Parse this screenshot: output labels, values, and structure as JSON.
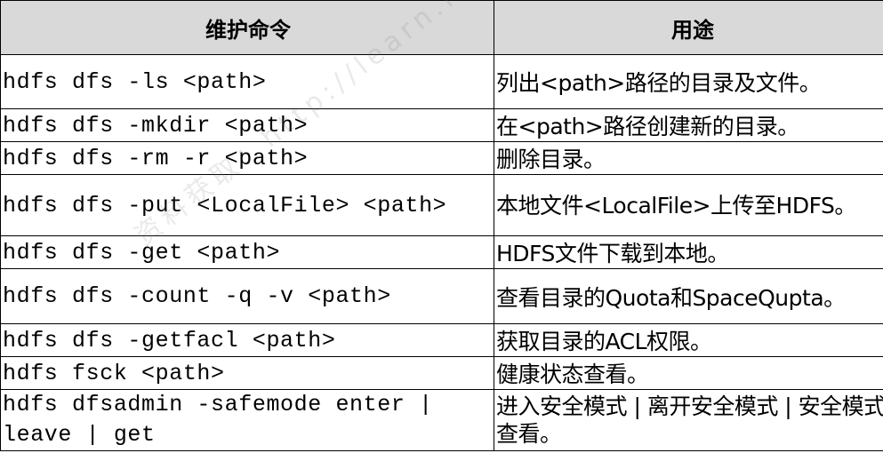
{
  "table": {
    "headers": [
      "维护命令",
      "用途"
    ],
    "rows": [
      {
        "command": "hdfs dfs -ls <path>",
        "usage": "列出<path>路径的目录及文件。"
      },
      {
        "command": "hdfs dfs -mkdir <path>",
        "usage": "在<path>路径创建新的目录。"
      },
      {
        "command": "hdfs dfs -rm -r <path>",
        "usage": "删除目录。"
      },
      {
        "command": "hdfs dfs -put <LocalFile> <path>",
        "usage": "本地文件<LocalFile>上传至HDFS。"
      },
      {
        "command": "hdfs dfs -get <path>",
        "usage": "HDFS文件下载到本地。"
      },
      {
        "command": "hdfs dfs -count -q -v <path>",
        "usage": "查看目录的Quota和SpaceQupta。"
      },
      {
        "command": "hdfs dfs -getfacl <path>",
        "usage": "获取目录的ACL权限。"
      },
      {
        "command": "hdfs fsck <path>",
        "usage": "健康状态查看。"
      },
      {
        "command": "hdfs dfsadmin -safemode enter | leave | get",
        "usage": "进入安全模式 | 离开安全模式 | 安全模式查看。"
      }
    ]
  },
  "watermark": "资料获取：http://learn.huawei.com"
}
